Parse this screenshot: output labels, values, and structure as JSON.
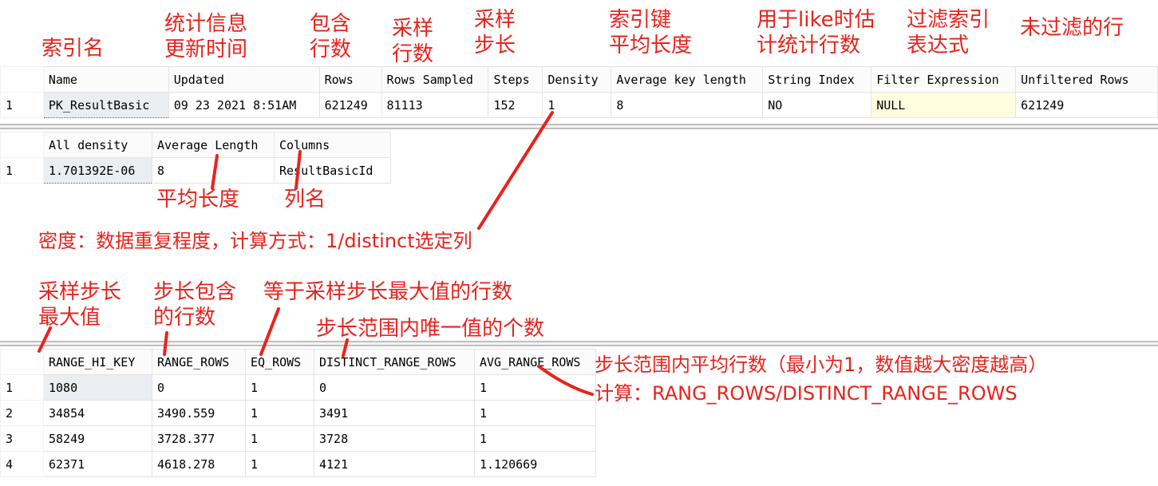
{
  "annotations": {
    "index_name": "索引名",
    "updated": "统计信息\n更新时间",
    "rows": "包含\n行数",
    "rows_sampled": "采样\n行数",
    "steps": "采样\n步长",
    "avg_key_length": "索引键\n平均长度",
    "string_index": "用于like时估\n计统计行数",
    "filter_expression": "过滤索引\n表达式",
    "unfiltered_rows": "未过滤的行",
    "average_length": "平均长度",
    "columns": "列名",
    "density": "密度：数据重复程度，计算方式：1/distinct选定列",
    "range_hi_key": "采样步长\n最大值",
    "range_rows": "步长包含\n的行数",
    "eq_rows": "等于采样步长最大值的行数",
    "distinct_range_rows": "步长范围内唯一值的个数",
    "avg_range_rows_1": "步长范围内平均行数（最小为1，数值越大密度越高）",
    "avg_range_rows_2": "计算：RANG_ROWS/DISTINCT_RANGE_ROWS"
  },
  "stats_header": {
    "columns": [
      "Name",
      "Updated",
      "Rows",
      "Rows Sampled",
      "Steps",
      "Density",
      "Average key length",
      "String Index",
      "Filter Expression",
      "Unfiltered Rows"
    ],
    "rows": [
      {
        "n": "1",
        "cells": [
          "PK_ResultBasic",
          "09 23 2021  8:51AM",
          "621249",
          "81113",
          "152",
          "1",
          "8",
          "NO",
          "NULL",
          "621249"
        ]
      }
    ]
  },
  "density_vector": {
    "columns": [
      "All density",
      "Average Length",
      "Columns"
    ],
    "rows": [
      {
        "n": "1",
        "cells": [
          "1.701392E-06",
          "8",
          "ResultBasicId"
        ]
      }
    ]
  },
  "histogram": {
    "columns": [
      "RANGE_HI_KEY",
      "RANGE_ROWS",
      "EQ_ROWS",
      "DISTINCT_RANGE_ROWS",
      "AVG_RANGE_ROWS"
    ],
    "rows": [
      {
        "n": "1",
        "cells": [
          "1080",
          "0",
          "1",
          "0",
          "1"
        ]
      },
      {
        "n": "2",
        "cells": [
          "34854",
          "3490.559",
          "1",
          "3491",
          "1"
        ]
      },
      {
        "n": "3",
        "cells": [
          "58249",
          "3728.377",
          "1",
          "3728",
          "1"
        ]
      },
      {
        "n": "4",
        "cells": [
          "62371",
          "4618.278",
          "1",
          "4121",
          "1.120669"
        ]
      }
    ]
  },
  "colors": {
    "annotation": "#e8231c",
    "selected_cell": "#eaedf1",
    "highlight_cell": "#ffffdf"
  }
}
